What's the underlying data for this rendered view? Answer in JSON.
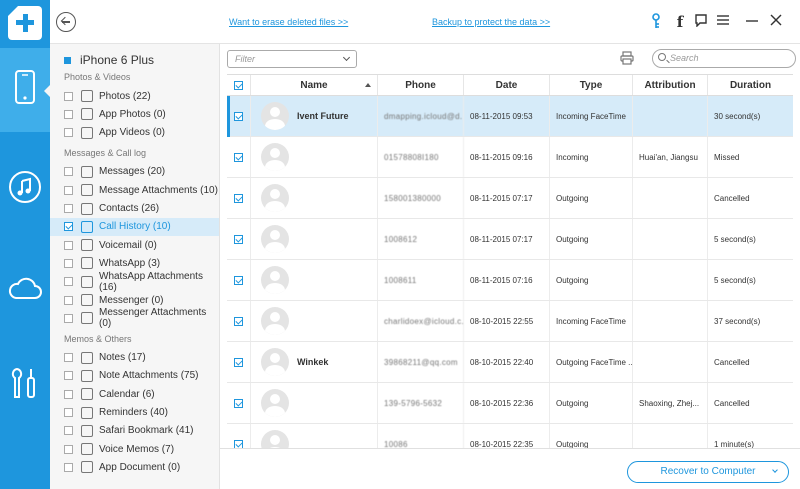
{
  "header": {
    "erase_link": "Want to erase deleted files >>",
    "backup_link": "Backup to protect the data >>"
  },
  "sidebar": {
    "device": "iPhone 6 Plus",
    "sections": [
      {
        "title": "Photos & Videos",
        "items": [
          {
            "label": "Photos (22)",
            "icon": "photos-icon"
          },
          {
            "label": "App Photos (0)",
            "icon": "app-photos-icon"
          },
          {
            "label": "App Videos (0)",
            "icon": "app-videos-icon"
          }
        ]
      },
      {
        "title": "Messages & Call log",
        "items": [
          {
            "label": "Messages (20)",
            "icon": "messages-icon"
          },
          {
            "label": "Message Attachments (10)",
            "icon": "attachment-icon"
          },
          {
            "label": "Contacts (26)",
            "icon": "contacts-icon"
          },
          {
            "label": "Call History (10)",
            "icon": "phone-icon",
            "active": true
          },
          {
            "label": "Voicemail (0)",
            "icon": "voicemail-icon"
          },
          {
            "label": "WhatsApp (3)",
            "icon": "whatsapp-icon"
          },
          {
            "label": "WhatsApp Attachments (16)",
            "icon": "attachment-icon"
          },
          {
            "label": "Messenger (0)",
            "icon": "messenger-icon"
          },
          {
            "label": "Messenger Attachments (0)",
            "icon": "attachment-icon"
          }
        ]
      },
      {
        "title": "Memos & Others",
        "items": [
          {
            "label": "Notes (17)",
            "icon": "notes-icon"
          },
          {
            "label": "Note Attachments (75)",
            "icon": "attachment-icon"
          },
          {
            "label": "Calendar (6)",
            "icon": "calendar-icon"
          },
          {
            "label": "Reminders (40)",
            "icon": "reminders-icon"
          },
          {
            "label": "Safari Bookmark (41)",
            "icon": "bookmark-icon"
          },
          {
            "label": "Voice Memos (7)",
            "icon": "microphone-icon"
          },
          {
            "label": "App Document (0)",
            "icon": "document-icon"
          }
        ]
      }
    ]
  },
  "toolbar": {
    "filter_placeholder": "Filter",
    "search_placeholder": "Search"
  },
  "table": {
    "columns": [
      "Name",
      "Phone",
      "Date",
      "Type",
      "Attribution",
      "Duration"
    ],
    "rows": [
      {
        "name": "Ivent Future",
        "phone": "dmapping.icloud@d...",
        "date": "08-11-2015 09:53",
        "type": "Incoming FaceTime",
        "attribution": "",
        "duration": "30 second(s)",
        "selected": true
      },
      {
        "name": "",
        "phone": "01578808I180",
        "date": "08-11-2015 09:16",
        "type": "Incoming",
        "attribution": "Huai'an, Jiangsu",
        "duration": "Missed"
      },
      {
        "name": "",
        "phone": "158001380000",
        "date": "08-11-2015 07:17",
        "type": "Outgoing",
        "attribution": "",
        "duration": "Cancelled"
      },
      {
        "name": "",
        "phone": "1008612",
        "date": "08-11-2015 07:17",
        "type": "Outgoing",
        "attribution": "",
        "duration": "5 second(s)"
      },
      {
        "name": "",
        "phone": "1008611",
        "date": "08-11-2015 07:16",
        "type": "Outgoing",
        "attribution": "",
        "duration": "5 second(s)"
      },
      {
        "name": "",
        "phone": "charlidoex@icloud.c...",
        "date": "08-10-2015 22:55",
        "type": "Incoming FaceTime",
        "attribution": "",
        "duration": "37 second(s)"
      },
      {
        "name": "Winkek",
        "phone": "39868211@qq.com",
        "date": "08-10-2015 22:40",
        "type": "Outgoing FaceTime ...",
        "attribution": "",
        "duration": "Cancelled"
      },
      {
        "name": "",
        "phone": "139-5796-5632",
        "date": "08-10-2015 22:36",
        "type": "Outgoing",
        "attribution": "Shaoxing, Zhej...",
        "duration": "Cancelled"
      },
      {
        "name": "",
        "phone": "10086",
        "date": "08-10-2015 22:35",
        "type": "Outgoing",
        "attribution": "",
        "duration": "1 minute(s)"
      }
    ]
  },
  "footer": {
    "recover_label": "Recover to Computer"
  },
  "colors": {
    "accent": "#1e96dd",
    "selected_row": "#d6ebf9",
    "sidebar_bg": "#f6f6f6"
  }
}
